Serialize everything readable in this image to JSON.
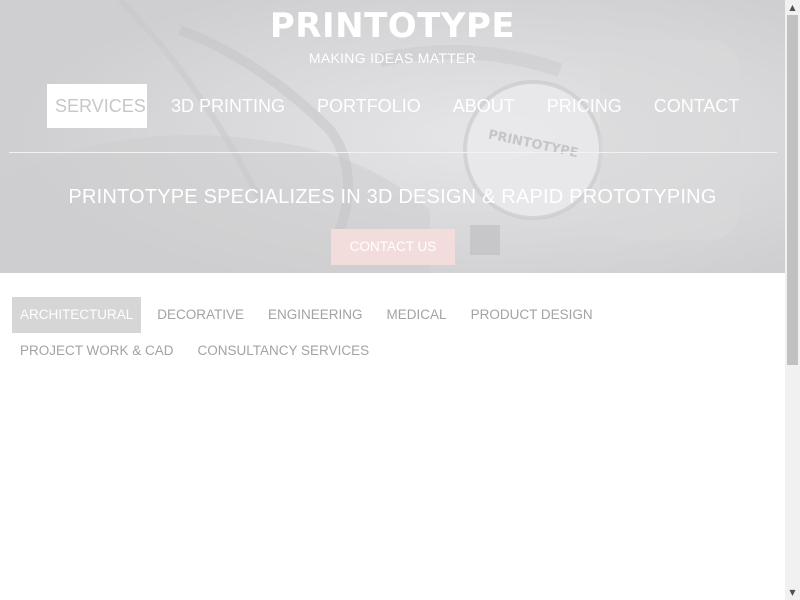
{
  "header": {
    "brand": "PRINTOTYPE",
    "tagline": "MAKING IDEAS MATTER",
    "stamp_text": "PRINTOTYPE"
  },
  "nav": {
    "items": [
      {
        "label": "SERVICES",
        "active": true
      },
      {
        "label": "3D PRINTING",
        "active": false
      },
      {
        "label": "PORTFOLIO",
        "active": false
      },
      {
        "label": "ABOUT",
        "active": false
      },
      {
        "label": "PRICING",
        "active": false
      },
      {
        "label": "CONTACT",
        "active": false
      }
    ]
  },
  "hero": {
    "headline": "PRINTOTYPE SPECIALIZES IN 3D DESIGN & RAPID PROTOTYPING",
    "cta_label": "CONTACT US"
  },
  "filters": {
    "row1": [
      {
        "label": "ARCHITECTURAL",
        "active": true
      },
      {
        "label": "DECORATIVE",
        "active": false
      },
      {
        "label": "ENGINEERING",
        "active": false
      },
      {
        "label": "MEDICAL",
        "active": false
      },
      {
        "label": "PRODUCT DESIGN",
        "active": false
      }
    ],
    "row2": [
      {
        "label": "PROJECT WORK & CAD",
        "active": false
      },
      {
        "label": "CONSULTANCY SERVICES",
        "active": false
      }
    ]
  },
  "colors": {
    "hero_overlay": "#d8d8da",
    "cta_background": "#f2dcdc",
    "active_filter": "#d6d6d6",
    "filter_text": "#a3a3a3"
  },
  "icons": {
    "scroll_up": "scroll-up-arrow-icon",
    "scroll_down": "scroll-down-arrow-icon"
  }
}
